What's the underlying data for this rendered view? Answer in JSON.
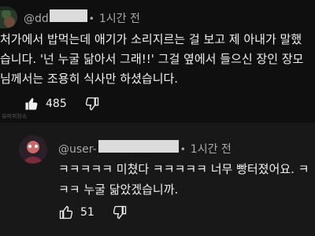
{
  "comments": [
    {
      "handle": "@dd",
      "time": "1시간 전",
      "text": "처가에서 밥먹는데 애기가 소리지르는 걸 보고 제 아내가 말했습니다. '넌 누굴 닮아서 그래!!' 그걸 옆에서 들으신 장인 장모님께서는 조용히 식사만 하셨습니다.",
      "likes": "485"
    },
    {
      "handle": "@user-",
      "time": "1시간 전",
      "text": "ㅋㅋㅋㅋㅋ 미쳤다 ㅋㅋㅋㅋㅋ 너무 빵터졌어요. ㅋㅋㅋ 누굴 닮았겠습니까.",
      "likes": "51"
    }
  ],
  "watermark": "유머저장소",
  "icons": {
    "like": "thumbs-up-icon",
    "dislike": "thumbs-down-icon",
    "dot": "dot-separator"
  },
  "colors": {
    "background": "#0f0f0f",
    "reply_background": "#181818",
    "meta": "#aaaaaa",
    "text": "#f1f1f1"
  }
}
